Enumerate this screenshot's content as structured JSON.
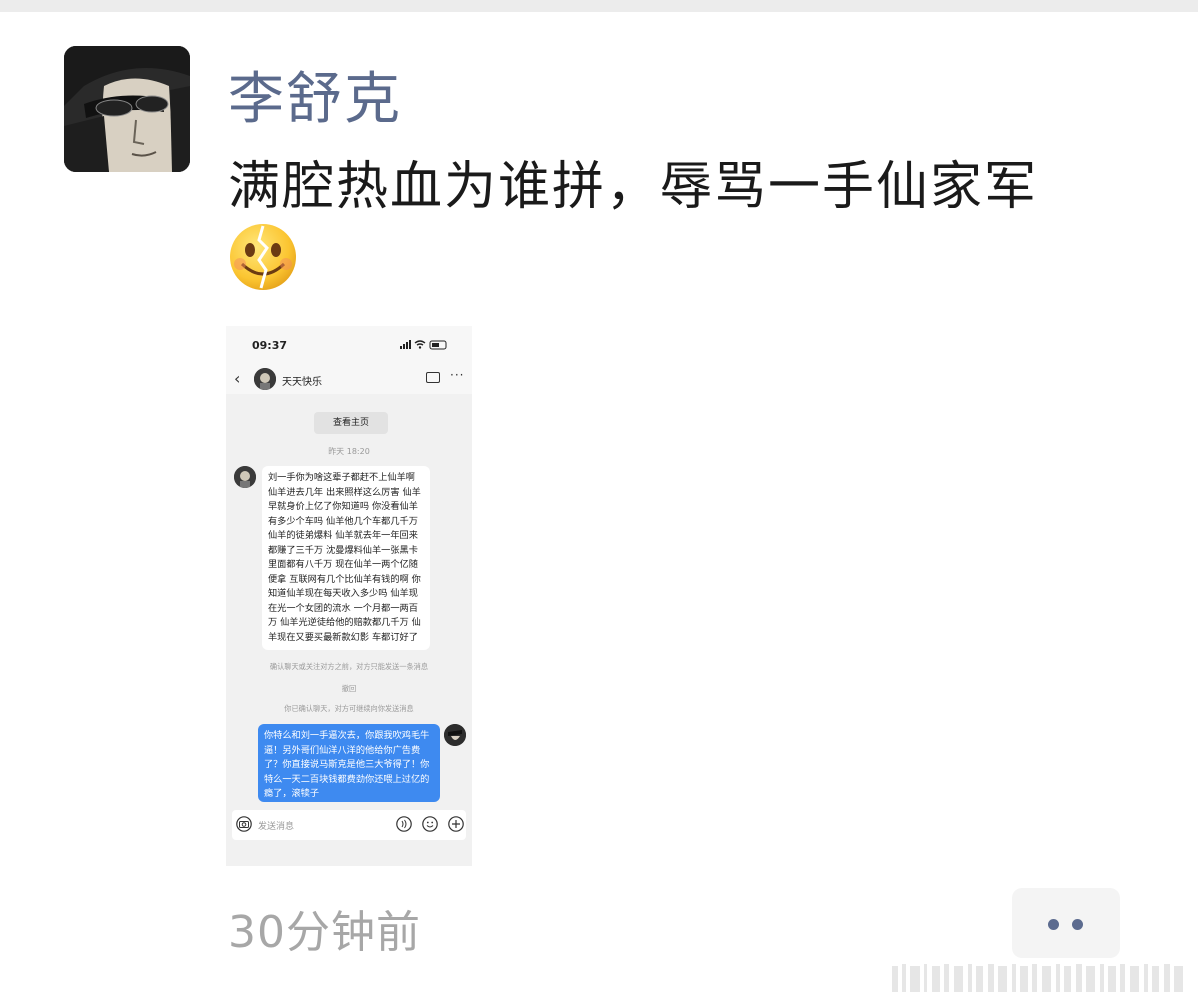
{
  "post": {
    "author": "李舒克",
    "text": "满腔热血为谁拼，辱骂一手仙家军",
    "emoji": "broken-smile-emoji",
    "time_ago": "30分钟前",
    "more_icon": "more-dots-icon"
  },
  "screenshot": {
    "status_time": "09:37",
    "chat_name": "天天快乐",
    "view_profile": "查看主页",
    "timestamp": "昨天 18:20",
    "received_message": "刘一手你为啥这辈子都赶不上仙羊啊 仙羊进去几年 出来照样这么厉害 仙羊早就身价上亿了你知道吗 你没看仙羊有多少个车吗 仙羊他几个车都几千万 仙羊的徒弟爆料 仙羊就去年一年回来都赚了三千万 沈曼爆料仙羊一张黑卡里面都有八千万 现在仙羊一两个亿随便拿 互联网有几个比仙羊有钱的啊 你知道仙羊现在每天收入多少吗 仙羊现在光一个女团的流水 一个月都一两百万 仙羊光逆徒给他的赔款都几千万 仙羊现在又要买最新款幻影 车都订好了",
    "system_note_1": "确认聊天或关注对方之前，对方只能发送一条消息",
    "system_note_2": "撤回",
    "system_note_3": "你已确认聊天，对方可继续向你发送消息",
    "sent_message": "你特么和刘一手逼次去，你跟我吹鸡毛牛逼！另外哥们仙洋八洋的他给你广告费了？你直接说马斯克是他三大爷得了！你特么一天二百块钱都费劲你还喂上过亿的瘾了，滚犊子",
    "input_placeholder": "发送消息"
  },
  "colors": {
    "author": "#5b6a8c",
    "sent_bubble": "#3e8af0",
    "dots": "#5c6b8f"
  }
}
